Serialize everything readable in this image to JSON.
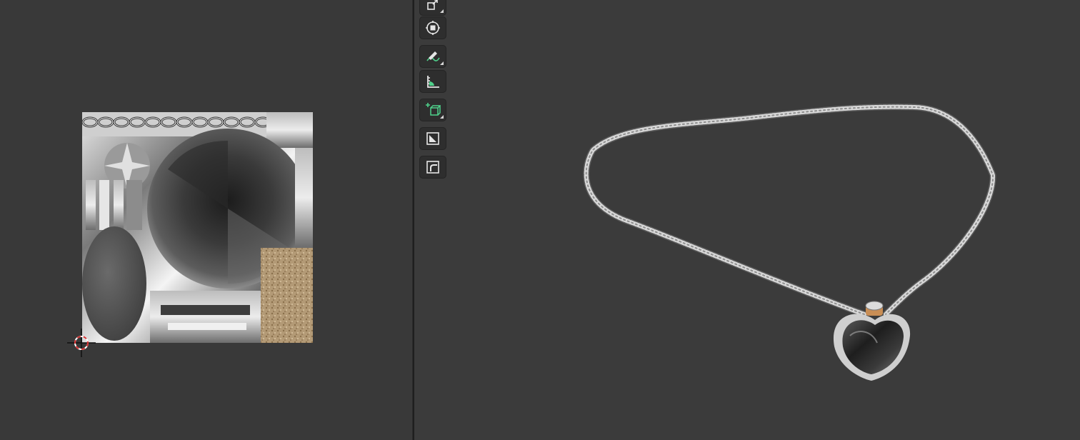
{
  "uv_editor": {
    "texture_name": "",
    "cursor_icon": "3d-cursor-icon"
  },
  "toolbar": {
    "tools": [
      {
        "name": "scale-cage-tool",
        "icon": "scale-cage-icon",
        "has_submenu": true
      },
      {
        "name": "transform-tool",
        "icon": "transform-icon",
        "has_submenu": false
      },
      {
        "name": "annotate-tool",
        "icon": "annotate-pencil-icon",
        "has_submenu": true
      },
      {
        "name": "measure-tool",
        "icon": "measure-ruler-icon",
        "has_submenu": false
      },
      {
        "name": "add-cube-tool",
        "icon": "add-cube-icon",
        "has_submenu": true
      },
      {
        "name": "extrude-region-tool",
        "icon": "extrude-region-icon",
        "has_submenu": false
      },
      {
        "name": "bevel-tool",
        "icon": "bevel-icon",
        "has_submenu": false
      }
    ]
  },
  "viewport": {
    "object": "heart-pendant-necklace"
  },
  "colors": {
    "background": "#3a3a3a",
    "button": "#2e2e2e",
    "accent_green": "#4fd18b",
    "cursor_red": "#d93030"
  }
}
